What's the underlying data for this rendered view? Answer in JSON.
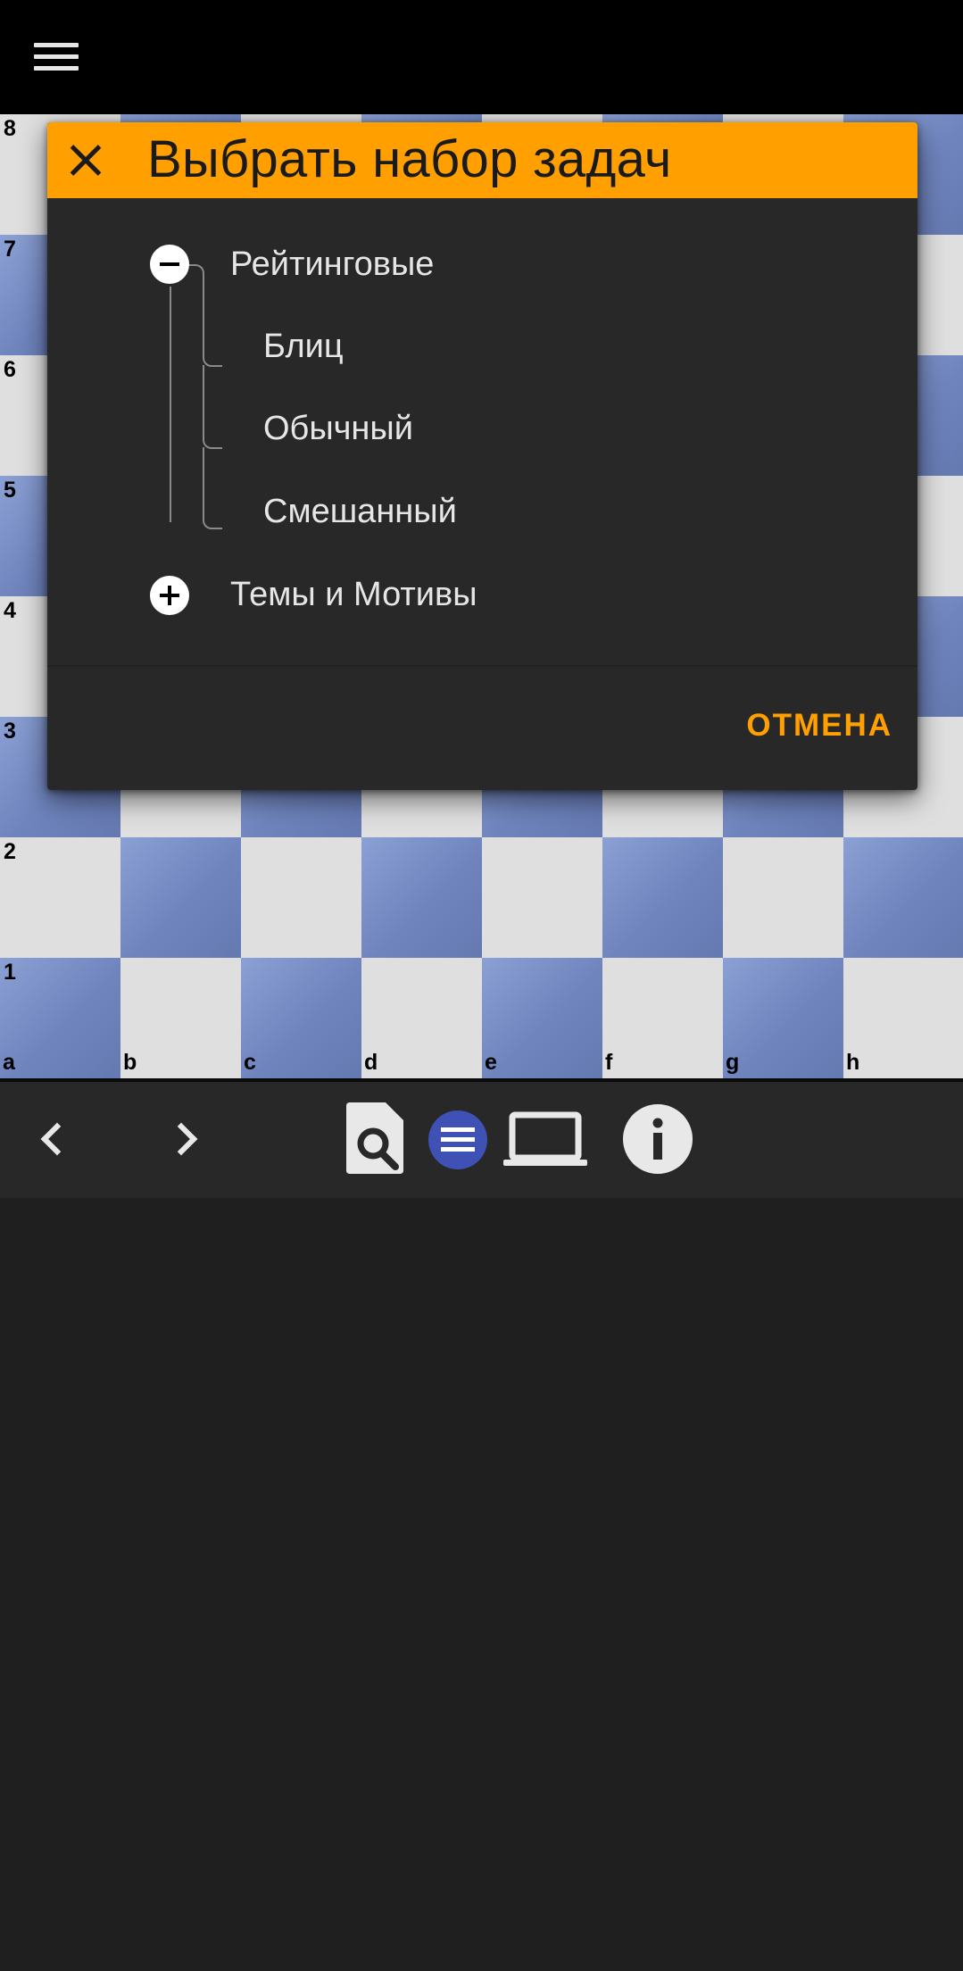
{
  "topbar": {
    "menu_icon": "hamburger-menu-icon"
  },
  "board": {
    "ranks": [
      "8",
      "7",
      "6",
      "5",
      "4",
      "3",
      "2",
      "1"
    ],
    "files": [
      "a",
      "b",
      "c",
      "d",
      "e",
      "f",
      "g",
      "h"
    ],
    "colors": {
      "light": "#dfdfdf",
      "dark": "#7489c2"
    }
  },
  "dialog": {
    "title": "Выбрать набор задач",
    "close_icon": "close-icon",
    "tree": {
      "group1": {
        "label": "Рейтинговые",
        "state": "expanded",
        "children": [
          "Блиц",
          "Обычный",
          "Смешанный"
        ]
      },
      "group2": {
        "label": "Темы и Мотивы",
        "state": "collapsed"
      }
    },
    "cancel_label": "ОТМЕНА",
    "accent_color": "#ffa000"
  },
  "toolbar": {
    "icons": [
      "chevron-left-icon",
      "chevron-right-icon",
      "file-search-icon",
      "list-icon",
      "laptop-icon",
      "info-icon"
    ],
    "active_color": "#3f51b5"
  }
}
